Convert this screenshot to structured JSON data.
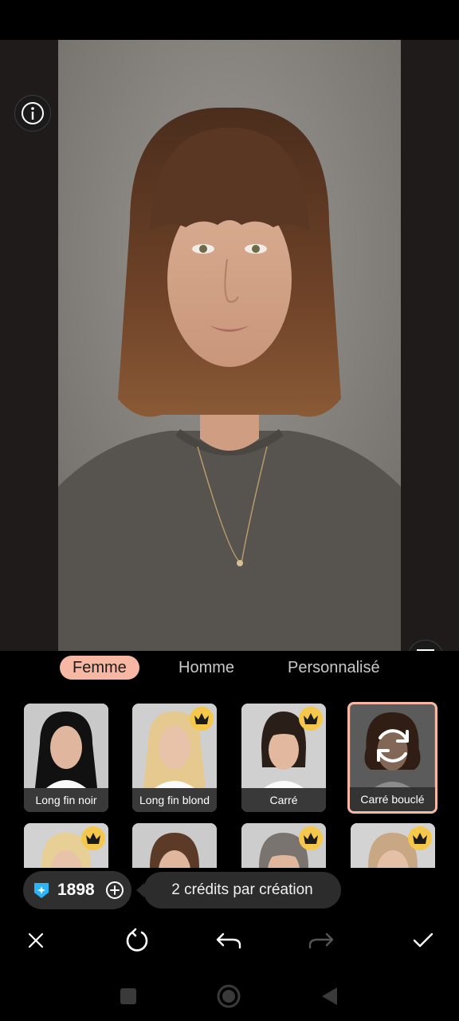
{
  "tabs": [
    {
      "label": "Femme",
      "active": true
    },
    {
      "label": "Homme",
      "active": false
    },
    {
      "label": "Personnalisé",
      "active": false
    }
  ],
  "styles": [
    {
      "label": "Long fin noir",
      "premium": false,
      "selected": false
    },
    {
      "label": "Long fin blond",
      "premium": true,
      "selected": false
    },
    {
      "label": "Carré",
      "premium": true,
      "selected": false
    },
    {
      "label": "Carré bouclé",
      "premium": false,
      "selected": true
    },
    {
      "label": "",
      "premium": true,
      "selected": false
    },
    {
      "label": "",
      "premium": false,
      "selected": false
    },
    {
      "label": "",
      "premium": true,
      "selected": false
    },
    {
      "label": "",
      "premium": true,
      "selected": false
    }
  ],
  "credits": {
    "count": "1898"
  },
  "tooltip": {
    "text": "2 crédits par création"
  },
  "colors": {
    "accent": "#f7b7a3",
    "crown": "#f5c84c",
    "gem": "#29b6f6"
  },
  "icons": [
    "info-icon",
    "compare-icon",
    "crown-icon",
    "refresh-icon",
    "gem-icon",
    "plus-circle-icon",
    "close-icon",
    "redo-circle-icon",
    "undo-icon",
    "redo-icon",
    "check-icon",
    "nav-recents-icon",
    "nav-home-icon",
    "nav-back-icon"
  ]
}
